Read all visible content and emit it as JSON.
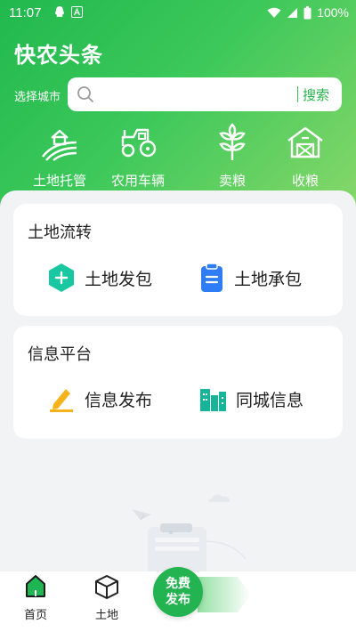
{
  "status_bar": {
    "time": "11:07",
    "battery": "100%"
  },
  "app_title": "快农头条",
  "search": {
    "city_label": "选择城市",
    "placeholder": "",
    "button_label": "搜索"
  },
  "categories": [
    {
      "label": "土地托管",
      "icon": "farmland-icon"
    },
    {
      "label": "农用车辆",
      "icon": "tractor-icon"
    },
    {
      "label": "卖粮",
      "icon": "wheat-icon"
    },
    {
      "label": "收粮",
      "icon": "barn-icon"
    }
  ],
  "land_card": {
    "title": "土地流转",
    "items": [
      {
        "label": "土地发包",
        "icon": "plus-hexagon-icon"
      },
      {
        "label": "土地承包",
        "icon": "clipboard-icon"
      }
    ]
  },
  "info_card": {
    "title": "信息平台",
    "items": [
      {
        "label": "信息发布",
        "icon": "pencil-icon"
      },
      {
        "label": "同城信息",
        "icon": "city-buildings-icon"
      }
    ]
  },
  "bottom_nav": {
    "items": [
      {
        "label": "首页",
        "icon": "home-icon"
      },
      {
        "label": "土地",
        "icon": "cube-icon"
      }
    ],
    "fab_line1": "免费",
    "fab_line2": "发布"
  },
  "colors": {
    "brand_green": "#23b451",
    "search_accent": "#27b34d",
    "page_bg": "#f2f3f5"
  }
}
